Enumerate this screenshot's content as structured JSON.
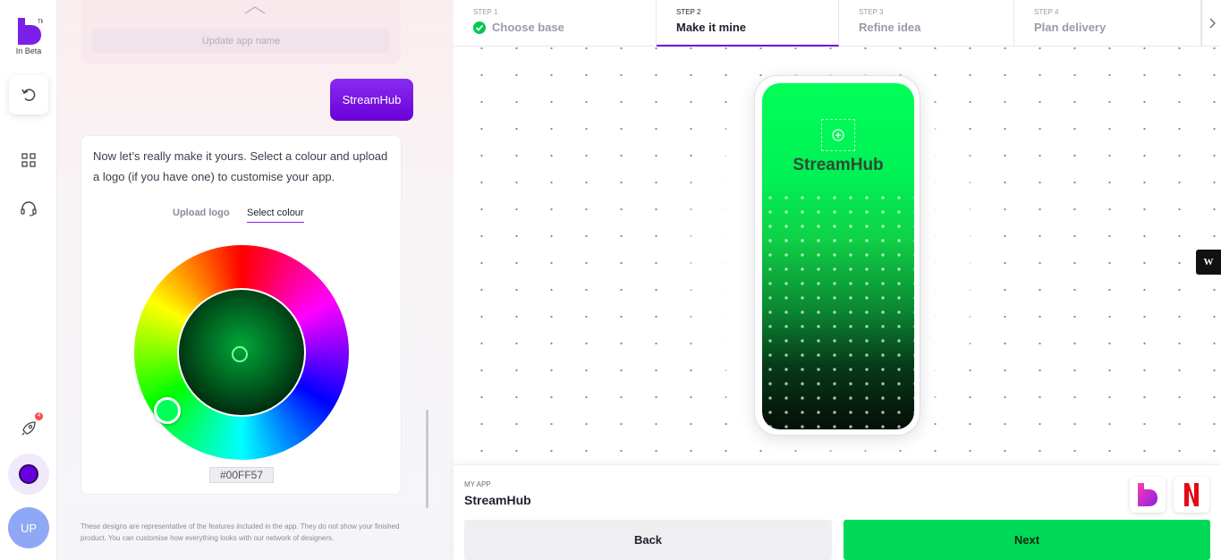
{
  "rail": {
    "logo_text": "In Beta",
    "badge_count": "4",
    "avatar_initials": "UP",
    "theme_color": "#6a00e0"
  },
  "chat": {
    "update_button": "Update app name",
    "user_message": "StreamHub",
    "bot_message": "Now let’s really make it yours. Select a colour and upload a logo (if you have one) to customise your app.",
    "tabs": [
      {
        "label": "Upload logo",
        "active": false
      },
      {
        "label": "Select colour",
        "active": true
      }
    ],
    "hex_value": "#00FF57",
    "disclaimer": "These designs are representative of the features included in the app. They do not show your finished product. You can customise how everything looks with our network of designers."
  },
  "steps": [
    {
      "num": "STEP 1",
      "label": "Choose base",
      "done": true
    },
    {
      "num": "STEP 2",
      "label": "Make it mine",
      "active": true
    },
    {
      "num": "STEP 3",
      "label": "Refine idea"
    },
    {
      "num": "STEP 4",
      "label": "Plan delivery"
    }
  ],
  "preview": {
    "app_name": "StreamHub",
    "primary_color": "#00FF57",
    "side_badge": "W"
  },
  "footer": {
    "caption": "MY APP",
    "app_name": "StreamHub",
    "back_label": "Back",
    "next_label": "Next",
    "brand_icons": [
      "builder-logo-icon",
      "netflix-logo-icon"
    ]
  },
  "colors": {
    "accent": "#6a00e0",
    "success": "#00d957",
    "selected": "#00FF57"
  }
}
